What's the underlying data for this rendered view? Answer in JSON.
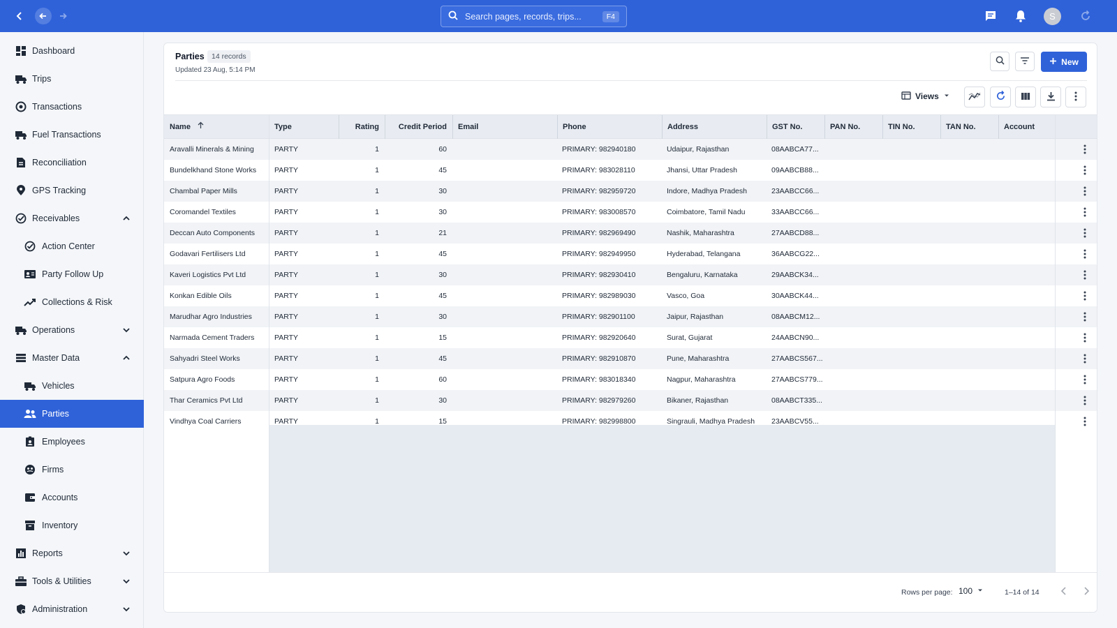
{
  "topbar": {
    "search_placeholder": "Search pages, records, trips...",
    "search_shortcut": "F4",
    "avatar_initial": "S"
  },
  "sidebar": {
    "items": [
      {
        "label": "Dashboard",
        "icon": "dashboard-icon"
      },
      {
        "label": "Trips",
        "icon": "truck-icon"
      },
      {
        "label": "Transactions",
        "icon": "transactions-icon"
      },
      {
        "label": "Fuel Transactions",
        "icon": "fuel-icon"
      },
      {
        "label": "Reconciliation",
        "icon": "document-icon"
      },
      {
        "label": "GPS Tracking",
        "icon": "location-pin-icon"
      },
      {
        "label": "Receivables",
        "icon": "check-circle-icon"
      },
      {
        "label": "Action Center",
        "icon": "check-circle-icon"
      },
      {
        "label": "Party Follow Up",
        "icon": "contact-card-icon"
      },
      {
        "label": "Collections & Risk",
        "icon": "trending-up-icon"
      },
      {
        "label": "Operations",
        "icon": "truck-icon"
      },
      {
        "label": "Master Data",
        "icon": "list-icon"
      },
      {
        "label": "Vehicles",
        "icon": "truck-icon"
      },
      {
        "label": "Parties",
        "icon": "people-icon"
      },
      {
        "label": "Employees",
        "icon": "badge-icon"
      },
      {
        "label": "Firms",
        "icon": "firm-icon"
      },
      {
        "label": "Accounts",
        "icon": "wallet-icon"
      },
      {
        "label": "Inventory",
        "icon": "archive-icon"
      },
      {
        "label": "Reports",
        "icon": "bar-chart-icon"
      },
      {
        "label": "Tools & Utilities",
        "icon": "toolbox-icon"
      },
      {
        "label": "Administration",
        "icon": "admin-shield-icon"
      }
    ]
  },
  "page": {
    "title": "Parties",
    "record_count": "14 records",
    "updated": "Updated 23 Aug, 5:14 PM",
    "new_button": "New",
    "views_label": "Views"
  },
  "table": {
    "columns": [
      "Name",
      "Type",
      "Rating",
      "Credit Period",
      "Email",
      "Phone",
      "Address",
      "GST No.",
      "PAN No.",
      "TIN No.",
      "TAN No.",
      "Account"
    ],
    "rows": [
      {
        "name": "Aravalli Minerals & Mining",
        "type": "PARTY",
        "rating": "1",
        "credit": "60",
        "email": "",
        "phone": "PRIMARY: 982940180",
        "address": "Udaipur, Rajasthan",
        "gst": "08AABCA77..."
      },
      {
        "name": "Bundelkhand Stone Works",
        "type": "PARTY",
        "rating": "1",
        "credit": "45",
        "email": "",
        "phone": "PRIMARY: 983028110",
        "address": "Jhansi, Uttar Pradesh",
        "gst": "09AABCB88..."
      },
      {
        "name": "Chambal Paper Mills",
        "type": "PARTY",
        "rating": "1",
        "credit": "30",
        "email": "",
        "phone": "PRIMARY: 982959720",
        "address": "Indore, Madhya Pradesh",
        "gst": "23AABCC66..."
      },
      {
        "name": "Coromandel Textiles",
        "type": "PARTY",
        "rating": "1",
        "credit": "30",
        "email": "",
        "phone": "PRIMARY: 983008570",
        "address": "Coimbatore, Tamil Nadu",
        "gst": "33AABCC66..."
      },
      {
        "name": "Deccan Auto Components",
        "type": "PARTY",
        "rating": "1",
        "credit": "21",
        "email": "",
        "phone": "PRIMARY: 982969490",
        "address": "Nashik, Maharashtra",
        "gst": "27AABCD88..."
      },
      {
        "name": "Godavari Fertilisers Ltd",
        "type": "PARTY",
        "rating": "1",
        "credit": "45",
        "email": "",
        "phone": "PRIMARY: 982949950",
        "address": "Hyderabad, Telangana",
        "gst": "36AABCG22..."
      },
      {
        "name": "Kaveri Logistics Pvt Ltd",
        "type": "PARTY",
        "rating": "1",
        "credit": "30",
        "email": "",
        "phone": "PRIMARY: 982930410",
        "address": "Bengaluru, Karnataka",
        "gst": "29AABCK34..."
      },
      {
        "name": "Konkan Edible Oils",
        "type": "PARTY",
        "rating": "1",
        "credit": "45",
        "email": "",
        "phone": "PRIMARY: 982989030",
        "address": "Vasco, Goa",
        "gst": "30AABCK44..."
      },
      {
        "name": "Marudhar Agro Industries",
        "type": "PARTY",
        "rating": "1",
        "credit": "30",
        "email": "",
        "phone": "PRIMARY: 982901100",
        "address": "Jaipur, Rajasthan",
        "gst": "08AABCM12..."
      },
      {
        "name": "Narmada Cement Traders",
        "type": "PARTY",
        "rating": "1",
        "credit": "15",
        "email": "",
        "phone": "PRIMARY: 982920640",
        "address": "Surat, Gujarat",
        "gst": "24AABCN90..."
      },
      {
        "name": "Sahyadri Steel Works",
        "type": "PARTY",
        "rating": "1",
        "credit": "45",
        "email": "",
        "phone": "PRIMARY: 982910870",
        "address": "Pune, Maharashtra",
        "gst": "27AABCS567..."
      },
      {
        "name": "Satpura Agro Foods",
        "type": "PARTY",
        "rating": "1",
        "credit": "60",
        "email": "",
        "phone": "PRIMARY: 983018340",
        "address": "Nagpur, Maharashtra",
        "gst": "27AABCS779..."
      },
      {
        "name": "Thar Ceramics Pvt Ltd",
        "type": "PARTY",
        "rating": "1",
        "credit": "30",
        "email": "",
        "phone": "PRIMARY: 982979260",
        "address": "Bikaner, Rajasthan",
        "gst": "08AABCT335..."
      },
      {
        "name": "Vindhya Coal Carriers",
        "type": "PARTY",
        "rating": "1",
        "credit": "15",
        "email": "",
        "phone": "PRIMARY: 982998800",
        "address": "Singrauli, Madhya Pradesh",
        "gst": "23AABCV55..."
      }
    ]
  },
  "pagination": {
    "rows_per_page_label": "Rows per page:",
    "rows_per_page_value": "100",
    "range": "1–14 of 14"
  },
  "colors": {
    "primary": "#2f62d9",
    "header_bg": "#e8ecf2"
  }
}
